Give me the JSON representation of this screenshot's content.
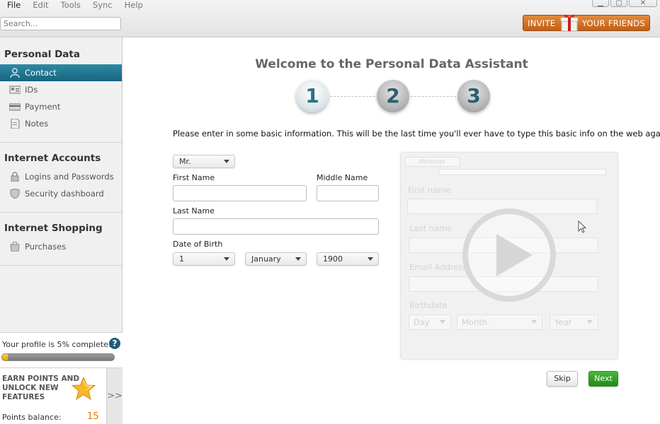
{
  "menubar": {
    "items": [
      "File",
      "Edit",
      "Tools",
      "Sync",
      "Help"
    ]
  },
  "search": {
    "placeholder": "Search..."
  },
  "invite": {
    "left_text": "INVITE",
    "right_text": "YOUR FRIENDS",
    "icon": "gift-icon"
  },
  "sidebar": {
    "sections": [
      {
        "title": "Personal Data",
        "items": [
          {
            "label": "Contact",
            "icon": "contact-icon",
            "active": true
          },
          {
            "label": "IDs",
            "icon": "id-card-icon"
          },
          {
            "label": "Payment",
            "icon": "credit-card-icon"
          },
          {
            "label": "Notes",
            "icon": "notes-icon"
          }
        ]
      },
      {
        "title": "Internet Accounts",
        "items": [
          {
            "label": "Logins and Passwords",
            "icon": "lock-icon"
          },
          {
            "label": "Security dashboard",
            "icon": "shield-icon"
          }
        ]
      },
      {
        "title": "Internet Shopping",
        "items": [
          {
            "label": "Purchases",
            "icon": "shopping-bag-icon"
          }
        ]
      }
    ],
    "profile": {
      "text": "Your profile is 5% complete!",
      "progress": 0.05
    },
    "earn": {
      "text": "EARN POINTS AND UNLOCK NEW FEATURES",
      "points_label": "Points balance:",
      "points_value": "15"
    },
    "expand_label": ">>"
  },
  "main": {
    "title": "Welcome to the Personal Data Assistant",
    "steps": [
      "1",
      "2",
      "3"
    ],
    "active_step": 1,
    "instructions": "Please enter in some basic information. This will be the last time you'll ever have to type this basic info on the web again!",
    "form": {
      "salutation": "Mr.",
      "first_name_label": "First Name",
      "middle_name_label": "Middle Name",
      "last_name_label": "Last Name",
      "dob_label": "Date of Birth",
      "dob_day": "1",
      "dob_month": "January",
      "dob_year": "1900"
    },
    "video": {
      "tab_label": "Webpage",
      "first_name": "First name",
      "last_name": "Last name",
      "email": "Email Address",
      "birthdate": "Birthdate",
      "day": "Day",
      "month": "Month",
      "year": "Year"
    },
    "buttons": {
      "skip": "Skip",
      "next": "Next"
    }
  },
  "colors": {
    "accent": "#17657f",
    "invite": "#c35f16",
    "next": "#23891a",
    "points": "#e07a00"
  }
}
